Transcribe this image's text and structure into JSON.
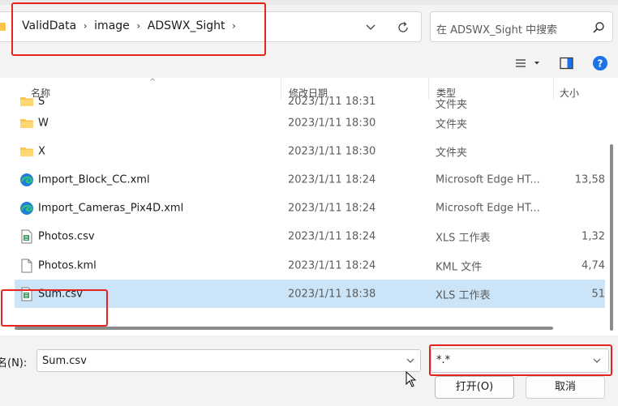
{
  "address": {
    "breadcrumbs": [
      "ValidData",
      "image",
      "ADSWX_Sight"
    ],
    "separator": "›"
  },
  "search": {
    "placeholder": "在 ADSWX_Sight 中搜索"
  },
  "columns": {
    "name": "名称",
    "date": "修改日期",
    "type": "类型",
    "size": "大小"
  },
  "files": [
    {
      "name": "S",
      "date": "2023/1/11 18:31",
      "type": "文件夹",
      "size": "",
      "icon": "folder-icon"
    },
    {
      "name": "W",
      "date": "2023/1/11 18:30",
      "type": "文件夹",
      "size": "",
      "icon": "folder-icon"
    },
    {
      "name": "X",
      "date": "2023/1/11 18:30",
      "type": "文件夹",
      "size": "",
      "icon": "folder-icon"
    },
    {
      "name": "Import_Block_CC.xml",
      "date": "2023/1/11 18:24",
      "type": "Microsoft Edge HT...",
      "size": "13,58",
      "icon": "edge-icon"
    },
    {
      "name": "Import_Cameras_Pix4D.xml",
      "date": "2023/1/11 18:24",
      "type": "Microsoft Edge HT...",
      "size": "",
      "icon": "edge-icon"
    },
    {
      "name": "Photos.csv",
      "date": "2023/1/11 18:24",
      "type": "XLS 工作表",
      "size": "1,32",
      "icon": "csv-icon"
    },
    {
      "name": "Photos.kml",
      "date": "2023/1/11 18:24",
      "type": "KML 文件",
      "size": "4,74",
      "icon": "file-icon"
    },
    {
      "name": "Sum.csv",
      "date": "2023/1/11 18:38",
      "type": "XLS 工作表",
      "size": "51",
      "icon": "csv-icon",
      "selected": true
    }
  ],
  "bottom": {
    "filename_label": "名(N):",
    "filename_value": "Sum.csv",
    "filter_value": "*.*",
    "open_label": "打开(O)",
    "cancel_label": "取消"
  },
  "colors": {
    "highlight_box": "#e52420",
    "selected_row": "#cce4f7",
    "help_blue": "#1a73e8"
  }
}
